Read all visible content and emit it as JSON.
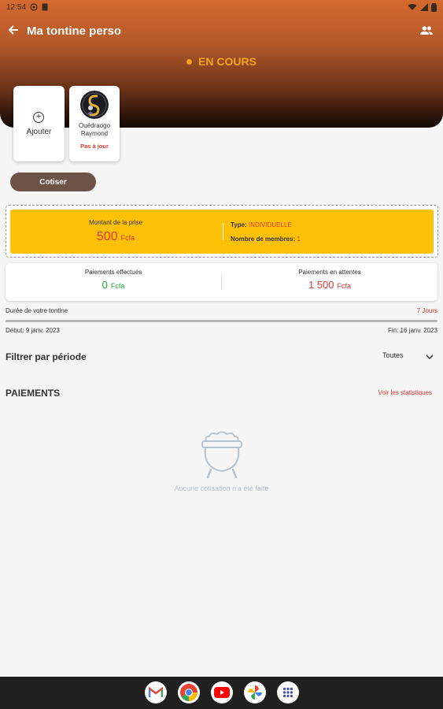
{
  "status_bar": {
    "time": "12:54"
  },
  "app_bar": {
    "title": "Ma tontine perso"
  },
  "tontine_status": "EN COURS",
  "add_member": {
    "label": "Ajouter"
  },
  "members": [
    {
      "name_line1": "Ouédraogo",
      "name_line2": "Raymond",
      "status": "Pas à jour"
    }
  ],
  "actions": {
    "contribute_label": "Cotiser"
  },
  "prize": {
    "label": "Montant de la prise",
    "amount": "500",
    "currency": "Fcfa",
    "type_label": "Type:",
    "type_value": "INDIVIDUELLE",
    "members_label": "Nombre de membres:",
    "members_value": "1"
  },
  "payments_summary": {
    "done_label": "Paiements effectués",
    "done_amount": "0",
    "pending_label": "Paiements en attentes",
    "pending_amount": "1 500",
    "currency": "Fcfa"
  },
  "duration": {
    "label": "Durée de votre tontine",
    "value": "7 Jours",
    "start": "Début: 9 janv. 2023",
    "end": "Fin: 16 janv. 2023",
    "progress_fraction": 1.0
  },
  "filter": {
    "title": "Filtrer par période",
    "selected": "Toutes"
  },
  "payments": {
    "title": "PAIEMENTS",
    "stats_link": "Voir les statistiques",
    "empty_message": "Aucune cotisation n'a été faite"
  },
  "colors": {
    "accent_orange": "#f2a51d",
    "red": "#e23a2f",
    "green": "#2e9e3e",
    "prize_yellow": "#ffc107",
    "button_brown": "#6d5347"
  },
  "dock_apps": [
    "gmail-icon",
    "chrome-icon",
    "youtube-icon",
    "photos-icon",
    "app-drawer-icon"
  ]
}
